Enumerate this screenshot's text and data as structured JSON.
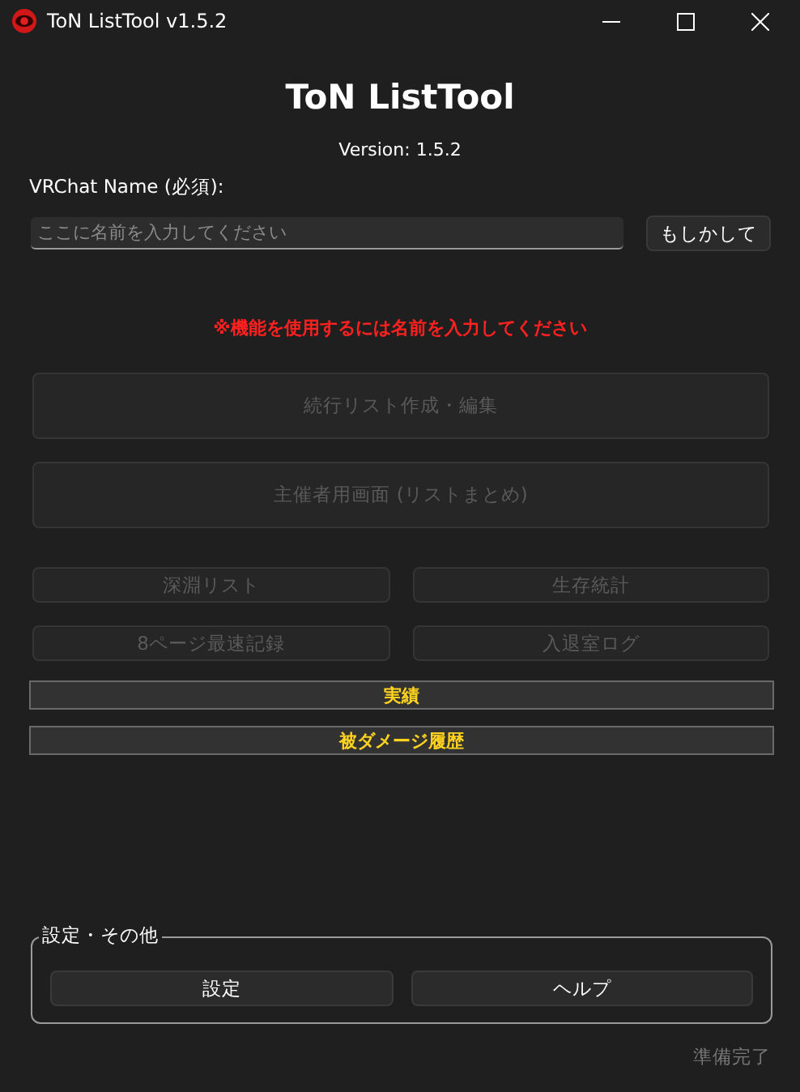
{
  "window": {
    "title": "ToN ListTool v1.5.2"
  },
  "header": {
    "title": "ToN ListTool",
    "version": "Version: 1.5.2"
  },
  "name_field": {
    "label": "VRChat Name (必須):",
    "placeholder": "ここに名前を入力してください",
    "button": "もしかして"
  },
  "warning": "※機能を使用するには名前を入力してください",
  "main_buttons": [
    {
      "label": "続行リスト作成・編集",
      "disabled": true
    },
    {
      "label": "主催者用画面 (リストまとめ)",
      "disabled": true
    }
  ],
  "grid_buttons": [
    {
      "label": "深淵リスト",
      "disabled": true
    },
    {
      "label": "生存統計",
      "disabled": true
    },
    {
      "label": "8ページ最速記録",
      "disabled": true
    },
    {
      "label": "入退室ログ",
      "disabled": true
    }
  ],
  "record_buttons": [
    {
      "label": "実績"
    },
    {
      "label": "被ダメージ履歴"
    }
  ],
  "settings": {
    "legend": "設定・その他",
    "buttons": [
      {
        "label": "設定"
      },
      {
        "label": "ヘルプ"
      }
    ]
  },
  "status_bar": "準備完了"
}
